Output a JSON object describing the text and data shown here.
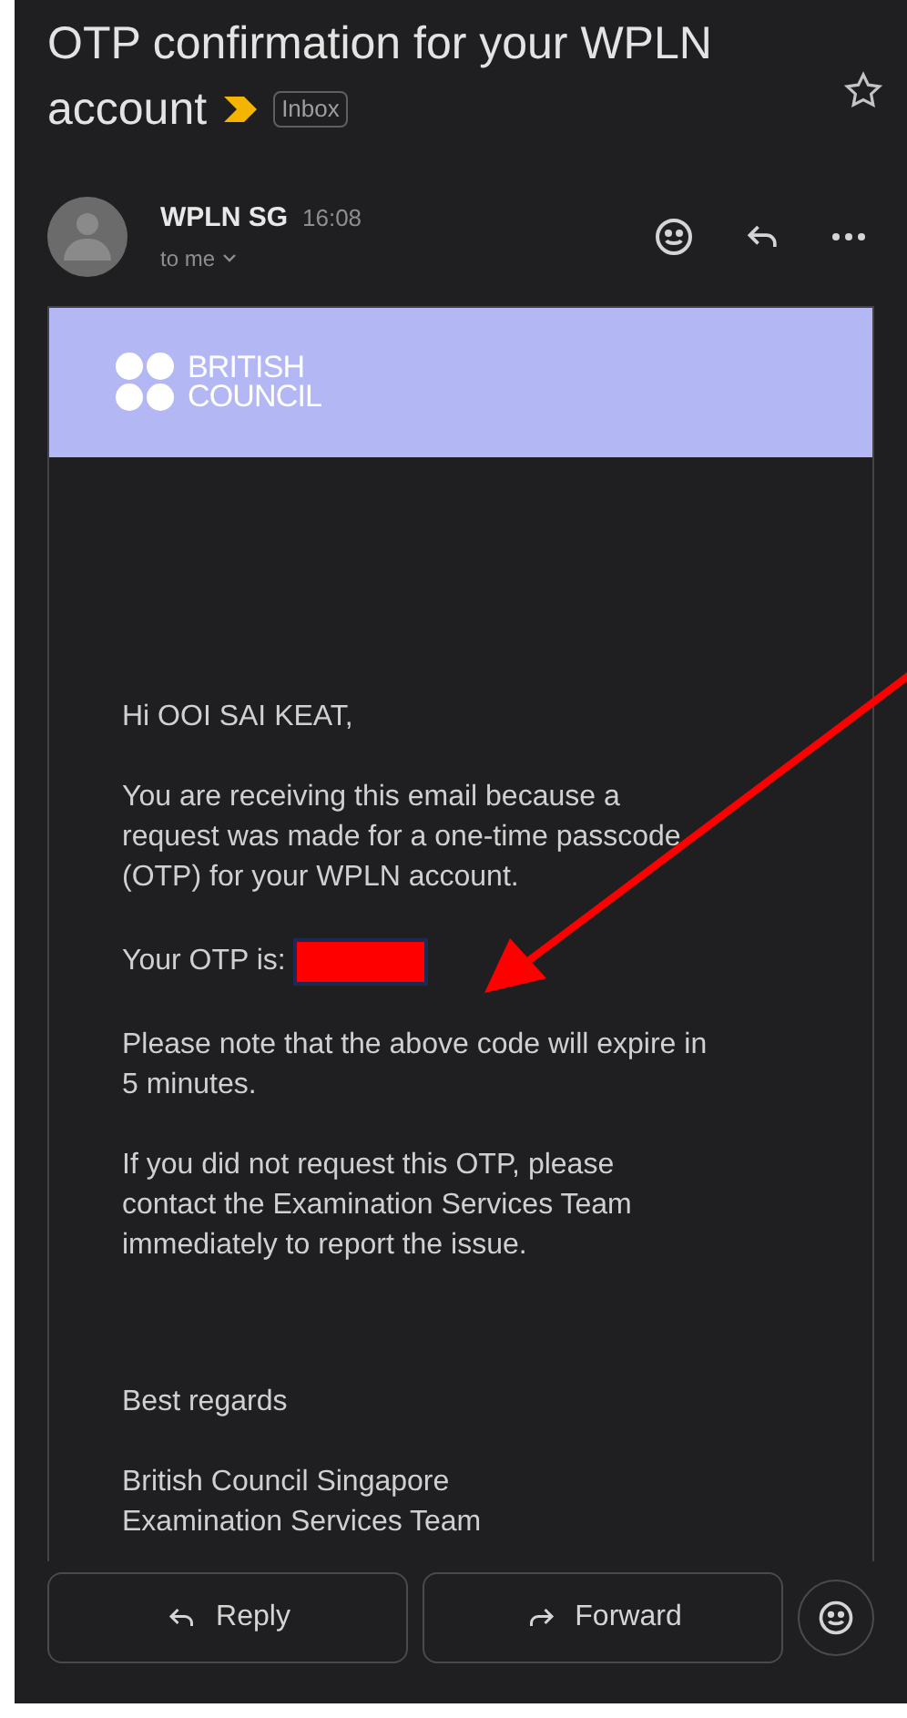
{
  "subject": {
    "lines": [
      "OTP confirmation for your WPLN",
      "account"
    ],
    "important": true,
    "label": "Inbox",
    "starred": false
  },
  "sender": {
    "name": "WPLN SG",
    "time": "16:08",
    "recipient": "to me"
  },
  "email": {
    "banner_logo": [
      "BRITISH",
      "COUNCIL"
    ],
    "paragraphs": [
      {
        "kind": "text",
        "lines": [
          "Hi OOI SAI KEAT,"
        ]
      },
      {
        "kind": "text",
        "lines": [
          "You are receiving this email because a",
          "request was made for a one-time passcode",
          "(OTP) for your WPLN account."
        ]
      },
      {
        "kind": "otp",
        "lines": [
          "Your OTP is:"
        ]
      },
      {
        "kind": "text",
        "lines": [
          "Please note that the above code will expire in",
          "5 minutes."
        ]
      },
      {
        "kind": "text",
        "lines": [
          "If you did not request this OTP, please",
          "contact the Examination Services Team",
          "immediately to report the issue."
        ]
      },
      {
        "kind": "gap"
      },
      {
        "kind": "text",
        "lines": [
          "Best regards"
        ]
      },
      {
        "kind": "text",
        "lines": [
          "British Council Singapore",
          "Examination Services Team"
        ]
      }
    ]
  },
  "actions": [
    {
      "kind": "reply",
      "label": "Reply"
    },
    {
      "kind": "forward",
      "label": "Forward"
    }
  ]
}
